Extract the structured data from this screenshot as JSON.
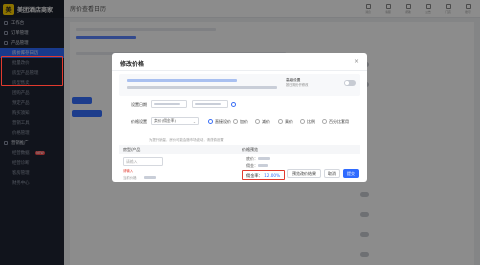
{
  "app": {
    "logo_text": "美团酒店商家",
    "logo_glyph": "美"
  },
  "sidebar": {
    "items": [
      {
        "label": "工作台",
        "type": "group"
      },
      {
        "label": "订单管理",
        "type": "group"
      },
      {
        "label": "产品管理",
        "type": "group"
      },
      {
        "label": "房价库存日历",
        "type": "sub",
        "active": true
      },
      {
        "label": "批量改价",
        "type": "sub",
        "active": false
      },
      {
        "label": "房型产品管理",
        "type": "sub"
      },
      {
        "label": "房型售卖",
        "type": "sub"
      },
      {
        "label": "团购产品",
        "type": "sub"
      },
      {
        "label": "预定产品",
        "type": "sub"
      },
      {
        "label": "购买须知",
        "type": "sub"
      },
      {
        "label": "营销工具",
        "type": "sub"
      },
      {
        "label": "价格管理",
        "type": "sub"
      },
      {
        "label": "营销推广",
        "type": "group"
      },
      {
        "label": "经营数据",
        "type": "sub",
        "badge": "NEW"
      },
      {
        "label": "经营诊断",
        "type": "sub"
      },
      {
        "label": "客房管理",
        "type": "sub"
      },
      {
        "label": "财务中心",
        "type": "sub"
      }
    ]
  },
  "topbar": {
    "title": "房价查看日历",
    "icons": [
      {
        "name": "message-icon",
        "label": "消息"
      },
      {
        "name": "service-icon",
        "label": "客服"
      },
      {
        "name": "help-icon",
        "label": "帮助"
      },
      {
        "name": "notice-icon",
        "label": "公告"
      },
      {
        "name": "store-icon",
        "label": "门店"
      },
      {
        "name": "user-icon",
        "label": "账号"
      }
    ]
  },
  "modal": {
    "title": "修改价格",
    "close_glyph": "×",
    "advanced_label": "高级设置",
    "advanced_sub": "按日期分开修改",
    "date_label": "设置日期",
    "price_label": "价格设置",
    "price_select": "卖价(佣金率)",
    "price_options": [
      "直接设价",
      "加价",
      "减价",
      "乘价",
      "比例",
      "百分比套用"
    ],
    "hint": "为提升销量，房价可能会随市场波动，请谨慎设置",
    "table_headers": [
      "房型/产品",
      "价格预览"
    ],
    "input_placeholder": "请输入",
    "error_text": "请输入",
    "current_label": "当前价格",
    "preview": {
      "line1_label": "底价：",
      "line2_label": "佣金：",
      "commission_label": "佣金率：",
      "commission_value": "12.00%"
    },
    "footer": {
      "preview_btn": "预览改价结果",
      "cancel_btn": "取消",
      "submit_btn": "提交"
    }
  },
  "colors": {
    "accent": "#2f6bff",
    "highlight": "#e23a2e",
    "sidebar_bg": "#1f2533"
  }
}
